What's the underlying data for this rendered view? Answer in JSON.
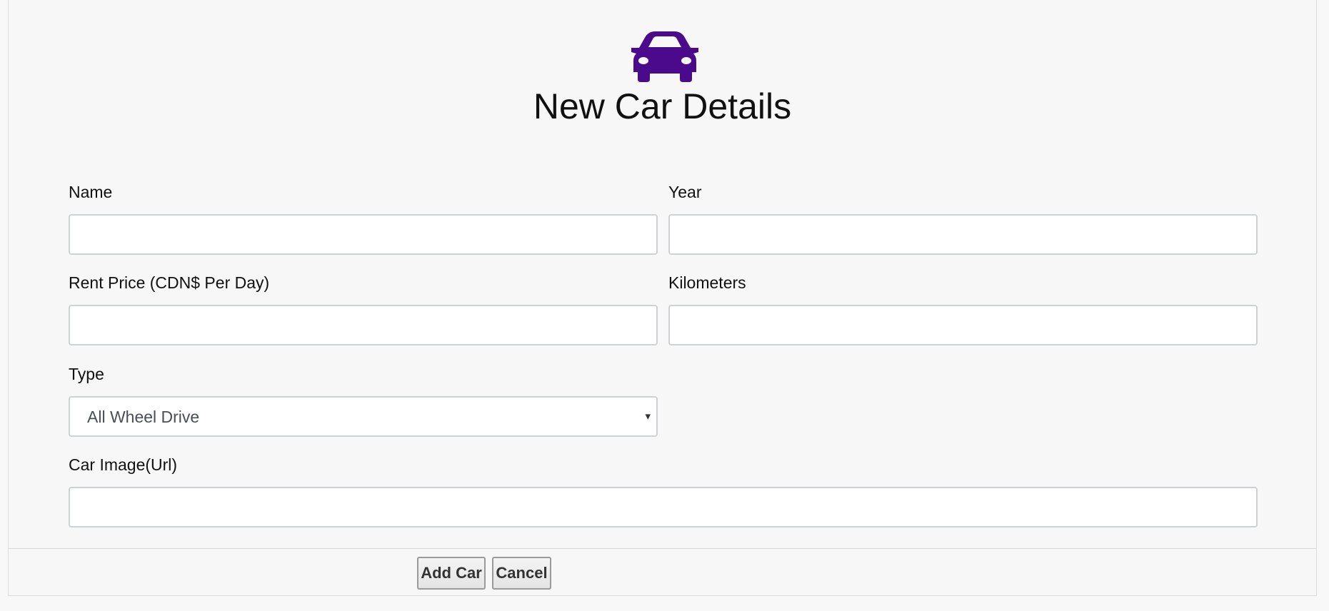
{
  "header": {
    "icon": "car-icon",
    "title": "New Car Details",
    "accent_color": "#4b0a8b"
  },
  "form": {
    "name": {
      "label": "Name",
      "value": "",
      "placeholder": ""
    },
    "year": {
      "label": "Year",
      "value": "",
      "placeholder": ""
    },
    "rent_price": {
      "label": "Rent Price (CDN$ Per Day)",
      "value": "",
      "placeholder": ""
    },
    "kilometers": {
      "label": "Kilometers",
      "value": "",
      "placeholder": ""
    },
    "type": {
      "label": "Type",
      "selected": "All Wheel Drive",
      "caret": "▾"
    },
    "car_image": {
      "label": "Car Image(Url)",
      "value": "",
      "placeholder": ""
    }
  },
  "actions": {
    "add_label": "Add Car",
    "cancel_label": "Cancel"
  }
}
